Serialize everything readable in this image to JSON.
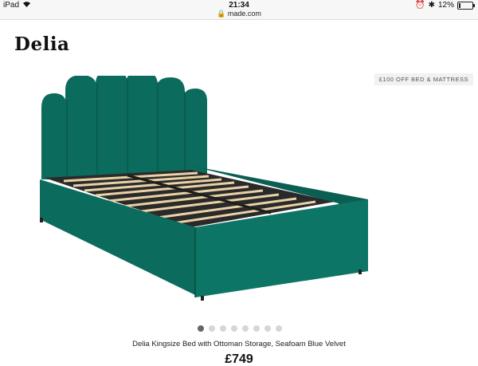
{
  "status_bar": {
    "device": "iPad",
    "time": "21:34",
    "url": "made.com",
    "battery_percent": "12%",
    "battery_level": 0.12
  },
  "product": {
    "title": "Delia",
    "promo_badge": "£100 OFF BED & MATTRESS",
    "caption": "Delia Kingsize Bed with Ottoman Storage, Seafoam Blue Velvet",
    "price": "£749",
    "image_count": 8,
    "active_image_index": 0
  },
  "colors": {
    "velvet": "#0b6b5c",
    "velvet_dark": "#06473d",
    "slat": "#e8d2a6",
    "active_dot": "#666666",
    "inactive_dot": "#d6d6d6"
  }
}
